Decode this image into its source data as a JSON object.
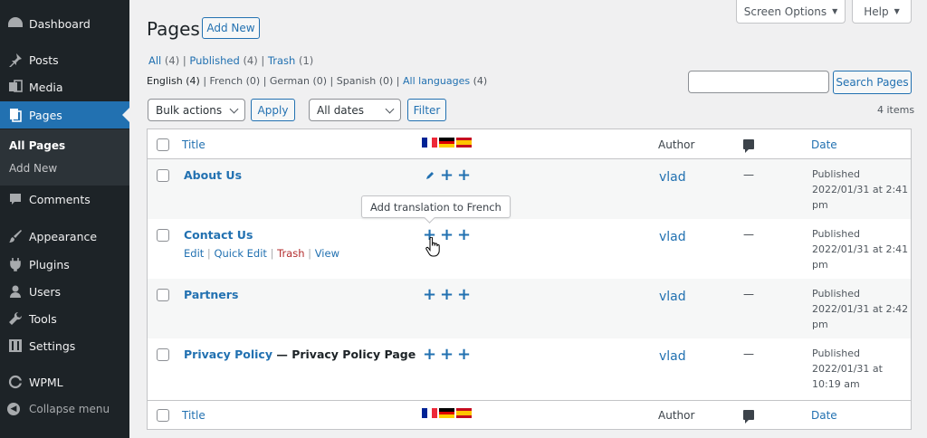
{
  "sidebar": {
    "items": [
      {
        "label": "Dashboard",
        "icon": "dashboard-icon"
      },
      {
        "label": "Posts",
        "icon": "pin-icon"
      },
      {
        "label": "Media",
        "icon": "media-icon"
      },
      {
        "label": "Pages",
        "icon": "pages-icon"
      },
      {
        "label": "Comments",
        "icon": "comment-icon"
      },
      {
        "label": "Appearance",
        "icon": "brush-icon"
      },
      {
        "label": "Plugins",
        "icon": "plugin-icon"
      },
      {
        "label": "Users",
        "icon": "user-icon"
      },
      {
        "label": "Tools",
        "icon": "wrench-icon"
      },
      {
        "label": "Settings",
        "icon": "settings-icon"
      },
      {
        "label": "WPML",
        "icon": "wpml-icon"
      }
    ],
    "submenu": [
      "All Pages",
      "Add New"
    ],
    "collapse": "Collapse menu"
  },
  "header": {
    "screen_options": "Screen Options",
    "help": "Help",
    "title": "Pages",
    "add_new": "Add New"
  },
  "filters": {
    "status": [
      {
        "label": "All",
        "count": "(4)"
      },
      {
        "label": "Published",
        "count": "(4)"
      },
      {
        "label": "Trash",
        "count": "(1)"
      }
    ],
    "languages": [
      {
        "label": "English",
        "count": "(4)"
      },
      {
        "label": "French",
        "count": "(0)"
      },
      {
        "label": "German",
        "count": "(0)"
      },
      {
        "label": "Spanish",
        "count": "(0)"
      },
      {
        "label": "All languages",
        "count": "(4)"
      }
    ],
    "search_button": "Search Pages",
    "bulk_actions": "Bulk actions",
    "apply": "Apply",
    "dates": "All dates",
    "filter": "Filter",
    "items_count": "4 items"
  },
  "table": {
    "columns": {
      "title": "Title",
      "author": "Author",
      "date": "Date"
    },
    "rows": [
      {
        "title": "About Us",
        "state": "",
        "author": "vlad",
        "comments": "—",
        "date": [
          "Published",
          "2022/01/31 at 2:41",
          "pm"
        ]
      },
      {
        "title": "Contact Us",
        "state": "",
        "author": "vlad",
        "comments": "—",
        "date": [
          "Published",
          "2022/01/31 at 2:41",
          "pm"
        ],
        "actions": [
          "Edit",
          "Quick Edit",
          "Trash",
          "View"
        ]
      },
      {
        "title": "Partners",
        "state": "",
        "author": "vlad",
        "comments": "—",
        "date": [
          "Published",
          "2022/01/31 at 2:42",
          "pm"
        ]
      },
      {
        "title": "Privacy Policy",
        "state": " — Privacy Policy Page",
        "author": "vlad",
        "comments": "—",
        "date": [
          "Published",
          "2022/01/31 at",
          "10:19 am"
        ]
      }
    ]
  },
  "tooltip": "Add translation to French",
  "colors": {
    "accent": "#2271b1",
    "sidebar": "#1d2327",
    "trash": "#b32d2e"
  }
}
